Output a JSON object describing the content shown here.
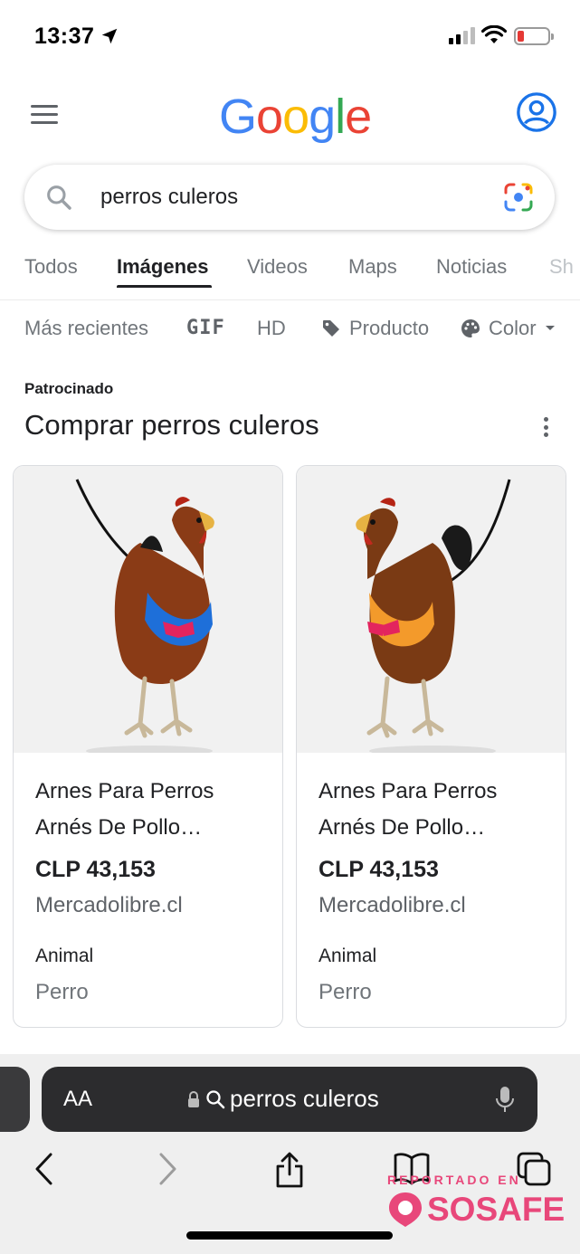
{
  "status_bar": {
    "time": "13:37"
  },
  "header": {
    "logo_letters": [
      {
        "char": "G",
        "color": "#4285F4"
      },
      {
        "char": "o",
        "color": "#EA4335"
      },
      {
        "char": "o",
        "color": "#FBBC05"
      },
      {
        "char": "g",
        "color": "#4285F4"
      },
      {
        "char": "l",
        "color": "#34A853"
      },
      {
        "char": "e",
        "color": "#EA4335"
      }
    ]
  },
  "search": {
    "query": "perros culeros"
  },
  "tabs": {
    "items": [
      "Todos",
      "Imágenes",
      "Videos",
      "Maps",
      "Noticias",
      "Sh"
    ],
    "active": "Imágenes"
  },
  "filters": {
    "recent": "Más recientes",
    "gif": "GIF",
    "hd": "HD",
    "product": "Producto",
    "color": "Color"
  },
  "ads": {
    "label": "Patrocinado",
    "title": "Comprar perros culeros",
    "products": [
      {
        "title": "Arnes Para Perros Arnés De Pollo…",
        "price": "CLP 43,153",
        "store": "Mercadolibre.cl",
        "attr_label": "Animal",
        "attr_value": "Perro",
        "vest_color": "#1e6fd9"
      },
      {
        "title": "Arnes Para Perros Arnés De Pollo…",
        "price": "CLP 43,153",
        "store": "Mercadolibre.cl",
        "attr_label": "Animal",
        "attr_value": "Perro",
        "vest_color": "#f39a2b"
      }
    ]
  },
  "safari": {
    "aa_label": "AA",
    "url": "perros culeros"
  },
  "watermark": {
    "top_text": "REPORTADO EN",
    "brand": "SOSAFE",
    "color": "#e8477a"
  }
}
